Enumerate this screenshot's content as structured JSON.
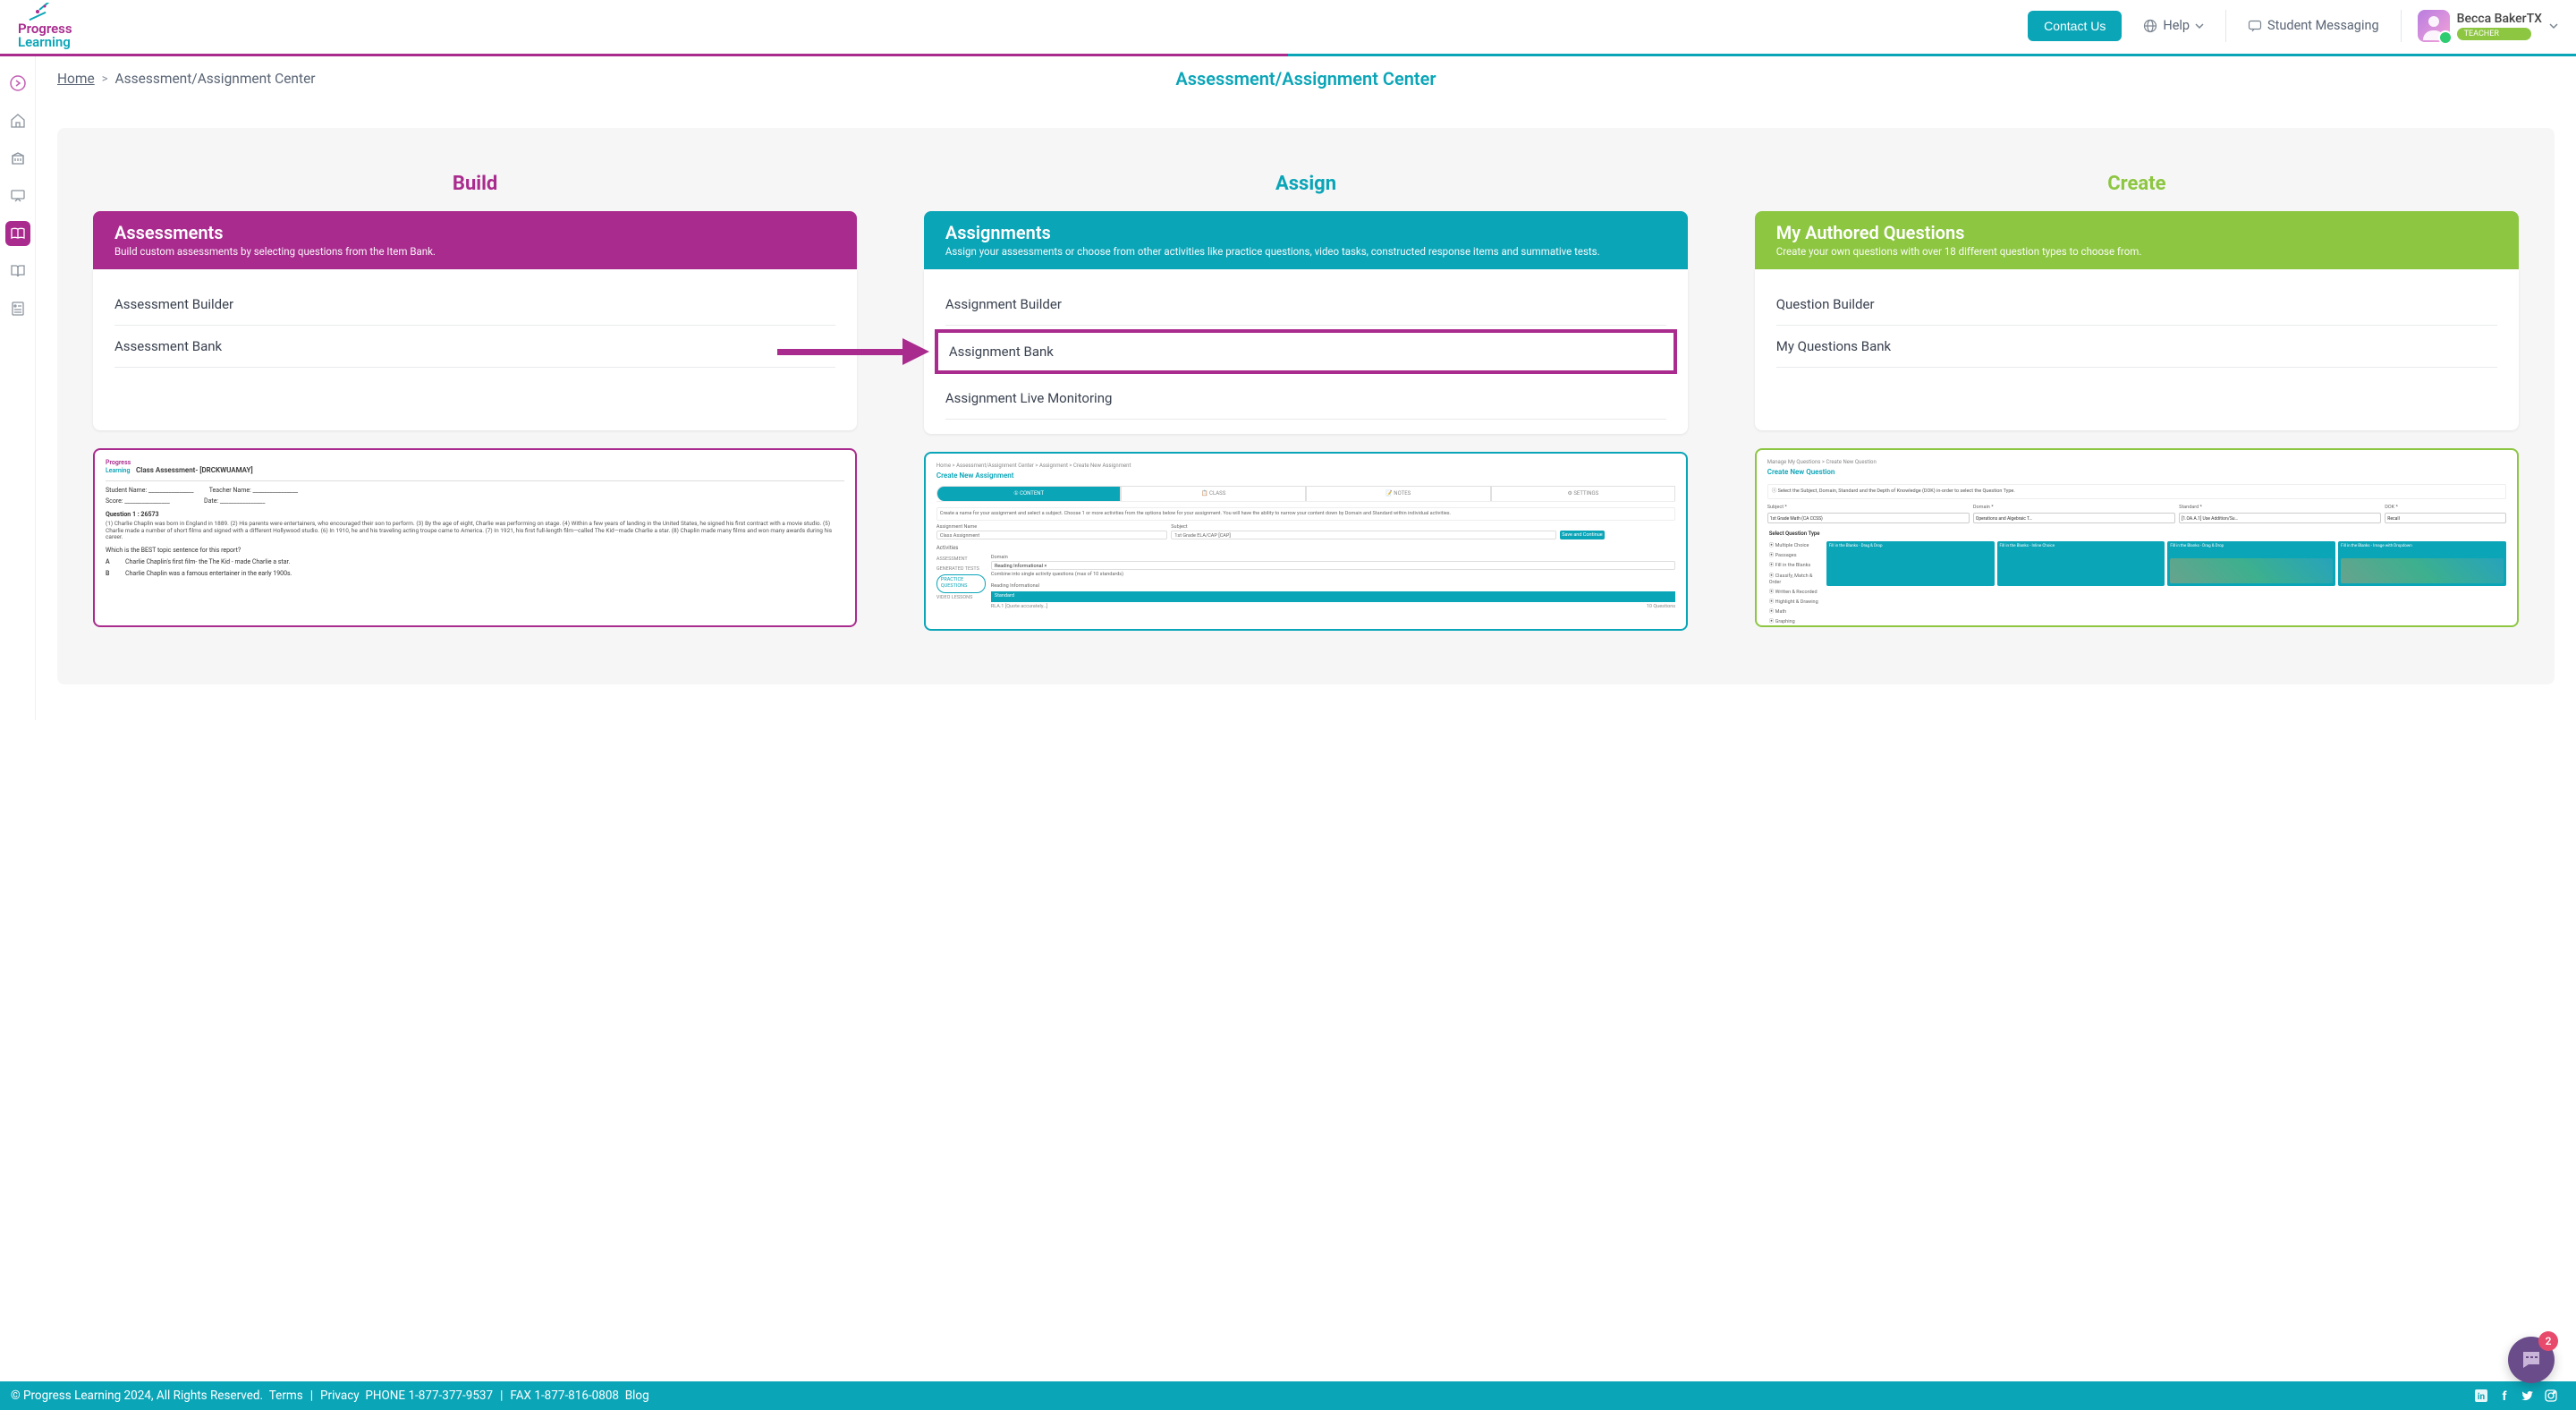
{
  "header": {
    "logo": {
      "line1": "Progress",
      "line2": "Learning"
    },
    "contact_btn": "Contact Us",
    "help_label": "Help",
    "messaging_label": "Student Messaging",
    "user_name": "Becca BakerTX",
    "user_role": "TEACHER"
  },
  "breadcrumb": {
    "home": "Home",
    "current": "Assessment/Assignment Center"
  },
  "page_title": "Assessment/Assignment Center",
  "columns": {
    "build": {
      "title": "Build",
      "card_title": "Assessments",
      "card_desc": "Build custom assessments by selecting questions from the Item Bank.",
      "links": [
        "Assessment Builder",
        "Assessment Bank"
      ],
      "preview": {
        "logo1": "Progress",
        "logo2": "Learning",
        "title": "Class Assessment- [DRCKWUAMAY]",
        "student_label": "Student Name:",
        "teacher_label": "Teacher Name:",
        "score_label": "Score:",
        "date_label": "Date:",
        "question_label": "Question 1 : 26573",
        "paragraph": "(1) Charlie Chaplin was born in England in 1889. (2) His parents were entertainers, who encouraged their son to perform. (3) By the age of eight, Charlie was performing on stage. (4) Within a few years of landing in the United States, he signed his first contract with a movie studio. (5) Charlie made a number of short films and signed with a different Hollywood studio. (6) In 1910, he and his traveling acting troupe came to America. (7) In 1921, his first full-length film—called The Kid—made Charlie a star. (8) Chaplin made many films and won many awards during his career.",
        "prompt": "Which is the BEST topic sentence for this report?",
        "opt_a_letter": "A",
        "opt_a": "Charlie Chaplin's first film- the The Kid - made Charlie a star.",
        "opt_b_letter": "B",
        "opt_b": "Charlie Chaplin was a famous entertainer in the early 1900s."
      }
    },
    "assign": {
      "title": "Assign",
      "card_title": "Assignments",
      "card_desc": "Assign your assessments or choose from other activities like practice questions, video tasks, constructed response items and summative tests.",
      "links": [
        "Assignment Builder",
        "Assignment Bank",
        "Assignment Live Monitoring"
      ],
      "preview": {
        "crumb": "Home   >   Assessment/Assignment Center   >   Assignment   >   Create New Assignment",
        "head": "Create New Assignment",
        "tab_content": "① CONTENT",
        "tab_class": "📋 CLASS",
        "tab_notes": "📝 NOTES",
        "tab_settings": "⚙ SETTINGS",
        "hint": "Create a name for your assignment and select a subject. Choose 1 or more activities from the options below for your assignment. You will have the ability to narrow your content down by Domain and Standard within individual activities.",
        "name_label": "Assignment Name",
        "name_val": "Class Assignment",
        "subject_label": "Subject",
        "subject_val": "1st Grade ELA/CAP [CAP]",
        "save_btn": "Save and Continue",
        "activities_label": "Activities",
        "act_assessment": "ASSESSMENT",
        "act_generated": "GENERATED TESTS",
        "act_practice": "PRACTICE QUESTIONS",
        "act_video": "VIDEO LESSONS",
        "domain_label": "Domain",
        "domain_val": "Reading Informational ×",
        "combine_label": "Combine into single activity questions (max of 10 standards)",
        "std_head": "Reading Informational",
        "std_sub": "Standard",
        "std_code": "RLA.1 [Quote accurately…]",
        "std_qs": "10 Questions"
      }
    },
    "create": {
      "title": "Create",
      "card_title": "My Authored Questions",
      "card_desc": "Create your own questions with over 18 different question types to choose from.",
      "links": [
        "Question Builder",
        "My Questions Bank"
      ],
      "preview": {
        "crumb": "Manage My Questions   >   Create New Question",
        "head": "Create New Question",
        "info": "ⓘ Select the Subject, Domain, Standard and the Depth of Knowledge (DOK) in-order to select the Question Type.",
        "subject_label": "Subject *",
        "subject_val": "1st Grade Math (CA CCSS)",
        "domain_label": "Domain *",
        "domain_val": "Operations and Algebraic T…",
        "standard_label": "Standard *",
        "standard_val": "[1.OA.A.1] Use Addition/Su…",
        "dok_label": "DOK *",
        "dok_val": "Recall",
        "section": "Select Question Type",
        "qt_list": [
          "⦿ Multiple Choice",
          "⦿ Passages",
          "⦿ Fill in the Blanks",
          "⦿ Classify, Match & Order",
          "⦿ Written & Recorded",
          "⦿ Highlight & Drawing",
          "⦿ Math",
          "⦿ Graphing"
        ],
        "tile1": "Fill in the Blanks - Drag & Drop",
        "tile2": "Fill in the Blanks - Inline Choice",
        "tile3": "Fill in the Blanks - Drag & Drop",
        "tile4": "Fill in the Blanks - Image with Dropdown"
      }
    }
  },
  "footer": {
    "copyright": "© Progress Learning 2024, All Rights Reserved.",
    "terms": "Terms",
    "privacy": "Privacy",
    "phone": "PHONE 1-877-377-9537",
    "fax": "FAX 1-877-816-0808",
    "blog": "Blog"
  },
  "chat_badge": "2"
}
